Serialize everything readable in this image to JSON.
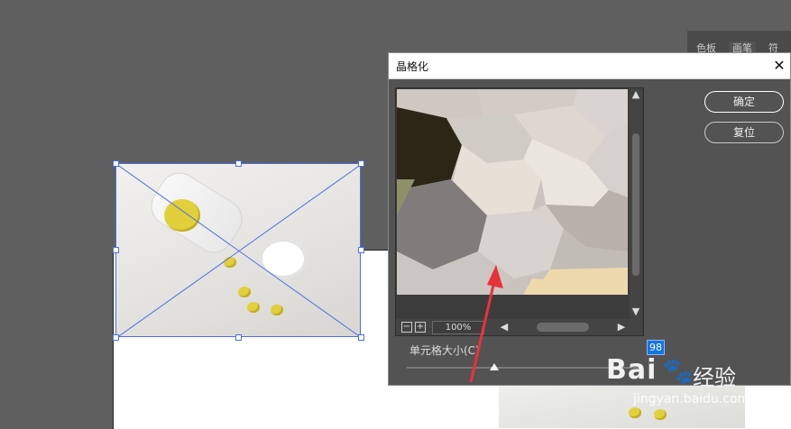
{
  "panel": {
    "tab1": "色板",
    "tab2": "画笔",
    "tab3": "符号"
  },
  "dialog": {
    "title": "晶格化",
    "close_glyph": "✕",
    "ok_label": "确定",
    "reset_label": "复位",
    "zoom": {
      "minus": "−",
      "plus": "+",
      "value": "100%"
    },
    "scroll": {
      "up": "▲",
      "down": "▼",
      "left": "◀",
      "right": "▶"
    },
    "cell_size_label": "单元格大小(C)",
    "cell_size_value": "98"
  },
  "watermark": {
    "logo": "Bai",
    "paw": "🐾",
    "cn": "经验",
    "url": "jingyan.baidu.com"
  },
  "colors": {
    "accent": "#1473e6",
    "selection": "#4a6fe6",
    "annotation_arrow": "#e8323a"
  },
  "icons": [
    "close-icon",
    "zoom-out-icon",
    "zoom-in-icon",
    "scroll-up-icon",
    "scroll-down-icon",
    "scroll-left-icon",
    "scroll-right-icon",
    "slider-thumb-icon",
    "red-arrow-icon"
  ]
}
